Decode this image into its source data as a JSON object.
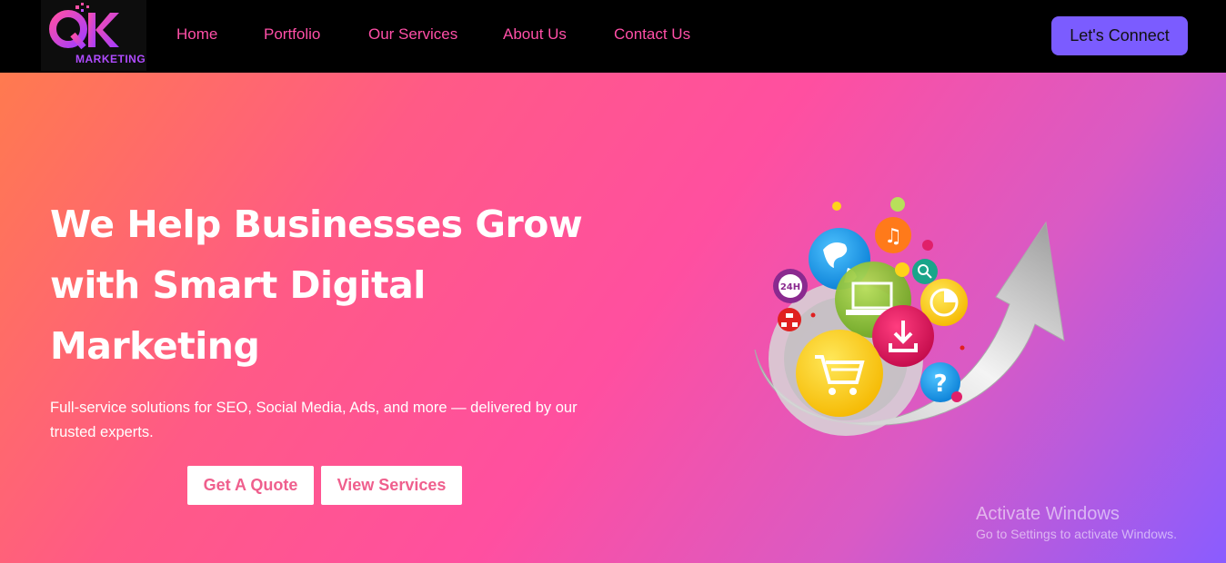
{
  "logo": {
    "letters": "QK",
    "subtitle": "MARKETING"
  },
  "nav": {
    "links": [
      {
        "label": "Home"
      },
      {
        "label": "Portfolio"
      },
      {
        "label": "Our Services"
      },
      {
        "label": "About Us"
      },
      {
        "label": "Contact Us"
      }
    ],
    "cta_label": "Let's Connect"
  },
  "hero": {
    "title_lines": [
      "We Help Businesses Grow",
      "with Smart Digital",
      "Marketing"
    ],
    "subtitle": "Full-service solutions for SEO, Social Media, Ads, and more — delivered by our trusted experts.",
    "primary_button": "Get A Quote",
    "secondary_button": "View Services",
    "illustration_labels": {
      "badge_24h": "24H"
    }
  },
  "watermark": {
    "title": "Activate Windows",
    "subtitle": "Go to Settings to activate Windows."
  },
  "colors": {
    "nav_bg": "#000000",
    "nav_link": "#ff4fa7",
    "cta_bg": "#7b5cff",
    "hero_gradient_start": "#ff7a4f",
    "hero_gradient_mid": "#ff4fa0",
    "hero_gradient_end": "#8a5cff"
  }
}
